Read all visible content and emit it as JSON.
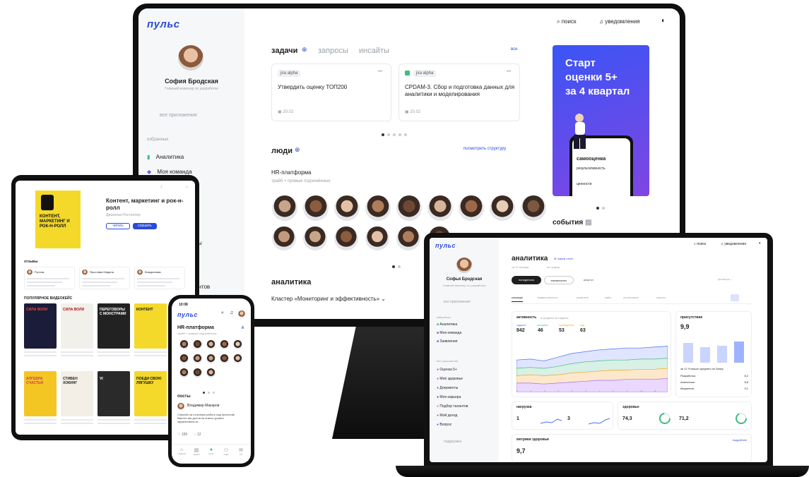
{
  "colors": {
    "brand": "#2a4bd7",
    "promo_start": "#3b54f5",
    "promo_end": "#7f45e2",
    "chart_blue": "#4a6cf7",
    "chart_green": "#3cbf7c",
    "chart_orange": "#f5a623"
  },
  "monitor": {
    "logo": "пульс",
    "search_label": "поиск",
    "notifications_label": "уведомления",
    "user_name": "София Бродская",
    "user_role": "Главный инженер по разработке",
    "all_apps": "все приложения",
    "favorites_label": "избранные",
    "sidebar_items": [
      "Аналитика",
      "Моя команда"
    ],
    "sidebar_partial": [
      "ы",
      "ентов"
    ],
    "tabs": [
      "задачи",
      "запросы",
      "инсайты"
    ],
    "all_link": "все",
    "tasks": [
      {
        "tag": "jira alpha",
        "title": "Утвердить оценку ТОП200",
        "date": "20.02",
        "more": "•••"
      },
      {
        "tag": "jira alpha",
        "title": "CPDAM-3. Сбор и подготовка данных для аналитики и моделирования",
        "date": "20.02",
        "more": "•••"
      }
    ],
    "people_title": "люди",
    "view_structure": "посмотреть структуру",
    "hr_title": "HR-платформа",
    "hr_subtitle": "трайб + прямые подчинённые",
    "analytics_title": "аналитика",
    "cluster_label": "Кластер «Мониторинг и эффективность»",
    "promo": {
      "line1": "Старт",
      "line2": "оценки 5+",
      "line3": "за 4 квартал",
      "phone_title": "самооценка",
      "phone_label1": "результативность",
      "phone_label2": "ценности"
    },
    "events_label": "события"
  },
  "tablet": {
    "book_title": "Контент, маркетинг и рок-н-ролл",
    "book_author": "Джонатан Ростеллер",
    "cover_text": "КОНТЕНТ, МАРКЕТИНГ И РОК-Н-РОЛЛ",
    "read_btn": "читать",
    "listen_btn": "слушать",
    "reviews_label": "отзывы",
    "reviewers": [
      "Рустам",
      "Ярослава Медина",
      "Владислава"
    ],
    "popular_label": "ПОПУЛЯРНОЕ ВИДЕОКЕЙС",
    "books_row1": [
      "СИЛА ВОЛИ",
      "СИЛА ВОЛИ",
      "ПЕРЕГОВОРЫ С МОНСТРАМИ",
      "КОНТЕНТ"
    ],
    "books_row2": [
      "АЛГЕБРА СЧАСТЬЯ",
      "СТИВЕН ХОКИНГ",
      "VI",
      "ПОЕДИ СВОЮ ЛЯГУШКУ"
    ]
  },
  "phone": {
    "time": "10:08",
    "logo": "пульс",
    "hr_title": "HR-платформа",
    "hr_subtitle": "трайб + прямые подчинённые",
    "posts_label": "посты",
    "post_author": "Владимир Макаров",
    "post_text": "Спасибо за отличную работу над проектом! Вместе мы достигли нового уровня эффективности.",
    "likes": "155",
    "comments": "12",
    "nav": [
      "главная",
      "заявки",
      "пульс",
      "люди",
      "чат"
    ]
  },
  "laptop": {
    "logo": "пульс",
    "search_label": "поиск",
    "notifications_label": "уведомления",
    "user_name": "Софья Бродская",
    "user_role": "Главный инженер по разработке",
    "all_apps": "все приложения",
    "favorites_label": "избранное",
    "favorites": [
      "Аналитика",
      "Моя команда",
      "Заявления"
    ],
    "other_label": "все приложения",
    "apps": [
      "Оценка 5+",
      "Моё здоровье",
      "Документы",
      "Моя карьера",
      "Подбор талантов",
      "Мой доход",
      "Вопрос"
    ],
    "support": "поддержка",
    "title": "аналитика",
    "new_report": "новый отчёт",
    "period": "за 12 месяца",
    "filter": "по отделу",
    "pills": [
      "понедельно",
      "ежемесячно",
      "квартал"
    ],
    "sub_tabs": [
      "команда",
      "эффективность",
      "развитие",
      "найм",
      "воспитание",
      "опросы"
    ],
    "chart_title": "активность",
    "chart_subtitle": "в среднем за неделю",
    "chart_legend": [
      "задачи",
      "встречи",
      "сообщения",
      "код"
    ],
    "chart_values": [
      "842",
      "46",
      "53",
      "63"
    ],
    "side_card_title": "присутствие",
    "side_card_value": "9,9",
    "side_card_caption": "за 12 % выше среднего по банку",
    "side_rows": [
      {
        "label": "Разработка",
        "value": "8,2"
      },
      {
        "label": "Аналитика",
        "value": "8,8"
      },
      {
        "label": "Маркетинг",
        "value": "9,1"
      }
    ],
    "load_title": "нагрузка",
    "load_values": [
      "1",
      "3"
    ],
    "health_title": "здоровье",
    "health_values": [
      "74,3",
      "71,2"
    ],
    "bottom_title": "метрики здоровья",
    "bottom_value": "9,7",
    "bottom_link": "подробнее"
  },
  "chart_data": {
    "type": "area",
    "title": "активность",
    "x": [
      "1",
      "2",
      "3",
      "4",
      "5",
      "6",
      "7",
      "8",
      "9",
      "10",
      "11",
      "12"
    ],
    "series": [
      {
        "name": "задачи",
        "values": [
          35,
          36,
          34,
          38,
          42,
          44,
          46,
          47,
          48,
          48,
          49,
          50
        ]
      },
      {
        "name": "встречи",
        "values": [
          26,
          27,
          26,
          28,
          31,
          33,
          34,
          35,
          35,
          36,
          36,
          37
        ]
      },
      {
        "name": "сообщения",
        "values": [
          18,
          19,
          18,
          19,
          21,
          22,
          23,
          24,
          24,
          25,
          25,
          26
        ]
      },
      {
        "name": "код",
        "values": [
          10,
          10,
          9,
          10,
          11,
          12,
          13,
          13,
          14,
          14,
          14,
          15
        ]
      }
    ],
    "grid": false,
    "legend": "top-left"
  }
}
